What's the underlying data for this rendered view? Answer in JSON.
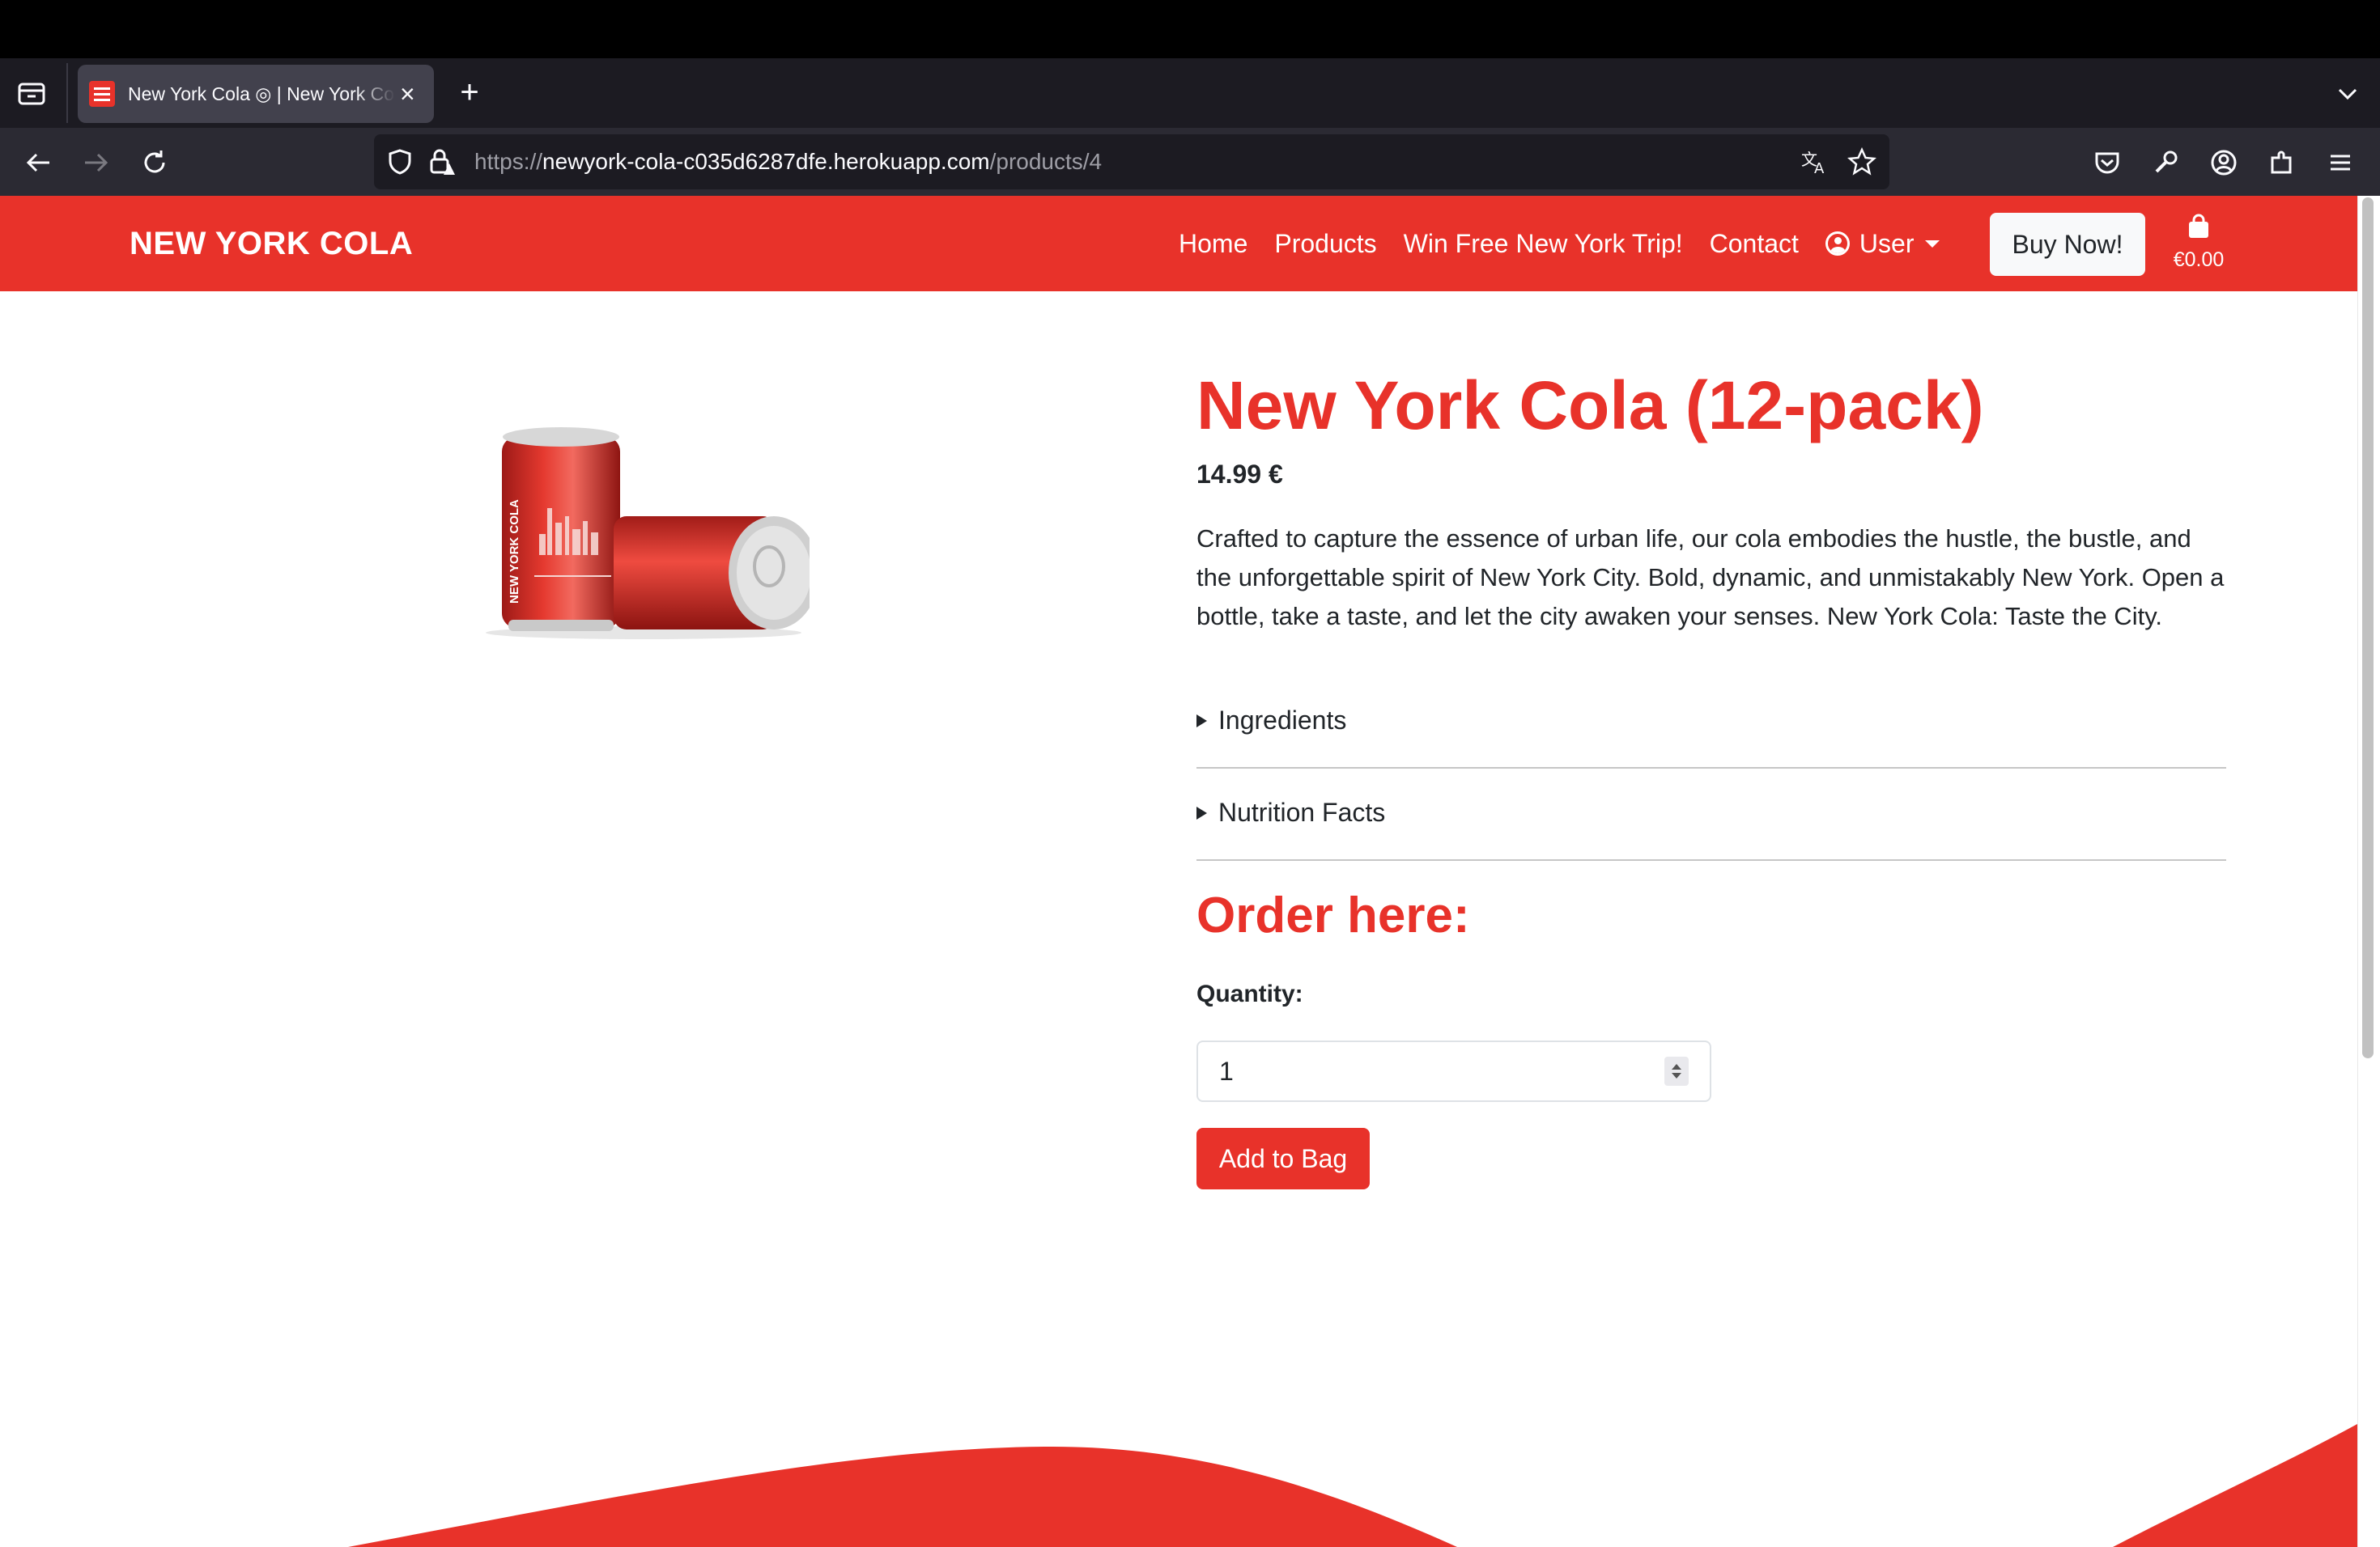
{
  "browser": {
    "tab_title": "New York Cola ◎ | New York Cola",
    "url_prefix": "https://",
    "url_host": "newyork-cola-c035d6287dfe.herokuapp.com",
    "url_path": "/products/4"
  },
  "header": {
    "brand": "NEW YORK COLA",
    "nav": [
      "Home",
      "Products",
      "Win Free New York Trip!",
      "Contact"
    ],
    "user_label": "User",
    "buy_button": "Buy Now!",
    "cart_total": "€0.00"
  },
  "product": {
    "title": "New York Cola (12-pack)",
    "price": "14.99 €",
    "description": "Crafted to capture the essence of urban life, our cola embodies the hustle, the bustle, and the unforgettable spirit of New York City. Bold, dynamic, and unmistakably New York. Open a bottle, take a taste, and let the city awaken your senses. New York Cola: Taste the City.",
    "ingredients_label": "Ingredients",
    "nutrition_label": "Nutrition Facts"
  },
  "order": {
    "title": "Order here:",
    "quantity_label": "Quantity:",
    "quantity_value": "1",
    "add_button": "Add to Bag"
  },
  "colors": {
    "brand_red": "#e8322a",
    "browser_dark": "#1c1b22"
  }
}
